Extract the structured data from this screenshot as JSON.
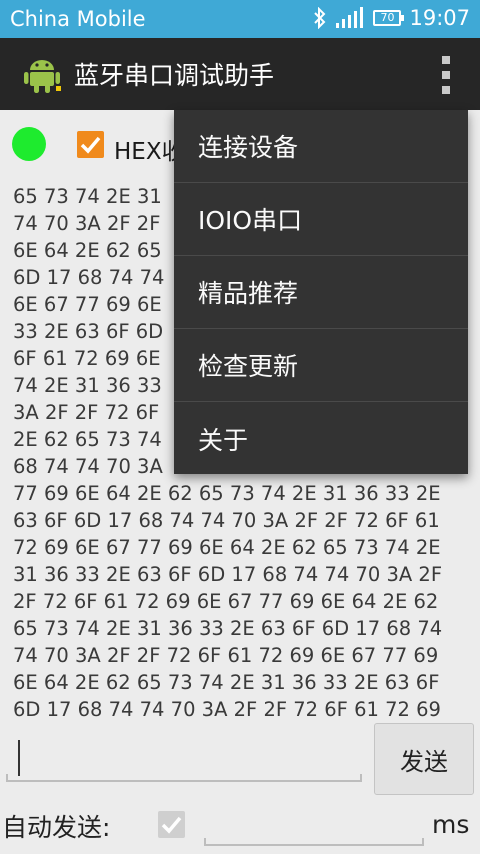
{
  "status_bar": {
    "carrier": "China Mobile",
    "battery": "70",
    "time": "19:07",
    "icons": [
      "bluetooth-icon",
      "signal-icon",
      "battery-icon"
    ]
  },
  "action_bar": {
    "title": "蓝牙串口调试助手",
    "logo_icon": "android-icon",
    "overflow_icon": "overflow-menu-icon"
  },
  "controls": {
    "connection_status_color": "#1eeb2e",
    "hex_checkbox_checked": true,
    "hex_label": "HEX收"
  },
  "data_lines": [
    "65 73 74 2E 31",
    "74 70 3A 2F 2F",
    "6E 64 2E 62 65",
    "6D 17 68 74 74",
    "6E 67 77 69 6E",
    "33 2E 63 6F 6D",
    "6F 61 72 69 6E",
    "74 2E 31 36 33",
    "3A 2F 2F 72 6F",
    "2E 62 65 73 74",
    "68 74 74 70 3A",
    "77 69 6E 64 2E 62 65 73 74 2E 31 36 33 2E",
    "63 6F 6D 17 68 74 74 70 3A 2F 2F 72 6F 61",
    "72 69 6E 67 77 69 6E 64 2E 62 65 73 74 2E",
    "31 36 33 2E 63 6F 6D 17 68 74 74 70 3A 2F",
    "2F 72 6F 61 72 69 6E 67 77 69 6E 64 2E 62",
    "65 73 74 2E 31 36 33 2E 63 6F 6D 17 68 74",
    "74 70 3A 2F 2F 72 6F 61 72 69 6E 67 77 69",
    "6E 64 2E 62 65 73 74 2E 31 36 33 2E 63 6F",
    "6D 17 68 74 74 70 3A 2F 2F 72 6F 61 72 69"
  ],
  "send_row": {
    "input_value": "",
    "send_label": "发送"
  },
  "auto_row": {
    "auto_send_label": "自动发送:",
    "auto_checked": true,
    "interval_value": "",
    "unit": "ms"
  },
  "menu": {
    "items": [
      "连接设备",
      "IOIO串口",
      "精品推荐",
      "检查更新",
      "关于"
    ]
  },
  "colors": {
    "status_bar": "#3fa9d6",
    "action_bar": "#262626",
    "accent": "#f08a1c",
    "menu_bg": "#333333"
  }
}
